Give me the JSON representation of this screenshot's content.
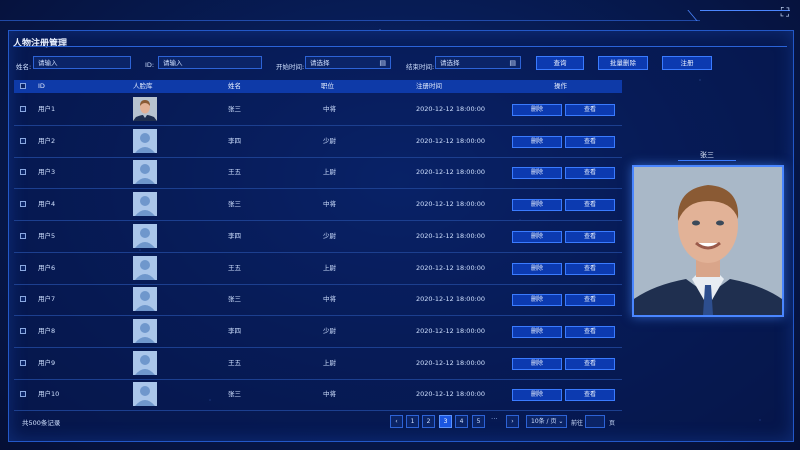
{
  "page": {
    "title": "人物注册管理"
  },
  "filters": {
    "name_label": "姓名:",
    "name_placeholder": "请输入",
    "id_label": "ID:",
    "id_placeholder": "请输入",
    "start_label": "开始时间:",
    "start_placeholder": "请选择",
    "end_label": "结束时间:",
    "end_placeholder": "请选择",
    "query_button": "查询",
    "batch_delete_button": "批量删除",
    "register_button": "注册"
  },
  "table": {
    "columns": [
      "ID",
      "人脸库",
      "姓名",
      "职位",
      "注册时间",
      "操作"
    ],
    "delete_label": "删除",
    "view_label": "查看",
    "rows": [
      {
        "id": "用户1",
        "name": "张三",
        "position": "中将",
        "time": "2020-12-12 18:00:00"
      },
      {
        "id": "用户2",
        "name": "李四",
        "position": "少尉",
        "time": "2020-12-12 18:00:00"
      },
      {
        "id": "用户3",
        "name": "王五",
        "position": "上尉",
        "time": "2020-12-12 18:00:00"
      },
      {
        "id": "用户4",
        "name": "张三",
        "position": "中将",
        "time": "2020-12-12 18:00:00"
      },
      {
        "id": "用户5",
        "name": "李四",
        "position": "少尉",
        "time": "2020-12-12 18:00:00"
      },
      {
        "id": "用户6",
        "name": "王五",
        "position": "上尉",
        "time": "2020-12-12 18:00:00"
      },
      {
        "id": "用户7",
        "name": "张三",
        "position": "中将",
        "time": "2020-12-12 18:00:00"
      },
      {
        "id": "用户8",
        "name": "李四",
        "position": "少尉",
        "time": "2020-12-12 18:00:00"
      },
      {
        "id": "用户9",
        "name": "王五",
        "position": "上尉",
        "time": "2020-12-12 18:00:00"
      },
      {
        "id": "用户10",
        "name": "张三",
        "position": "中将",
        "time": "2020-12-12 18:00:00"
      }
    ]
  },
  "pagination": {
    "total": "共500条记录",
    "prev": "‹",
    "next": "›",
    "pages": [
      "1",
      "2",
      "3",
      "4",
      "5"
    ],
    "active_page": "3",
    "ellipsis": "···",
    "page_size": "10条 / 页 ⌄",
    "goto_label": "前往",
    "page_suffix": "页"
  },
  "preview": {
    "name": "张三"
  },
  "icons": {
    "calendar": "calendar-icon",
    "fullscreen": "fullscreen-icon"
  },
  "colors": {
    "accent": "#3a7bff",
    "header": "#0e3aa8",
    "background": "#071c55"
  }
}
